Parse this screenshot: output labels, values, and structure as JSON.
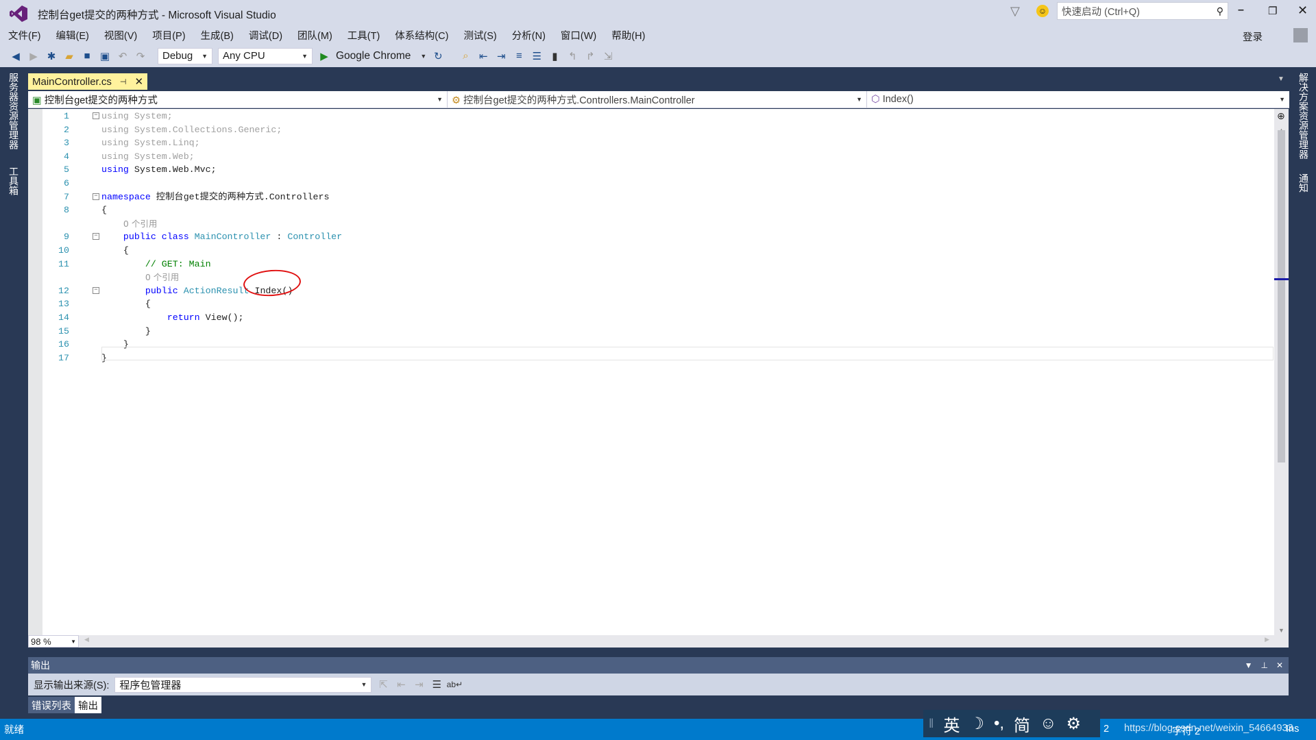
{
  "window": {
    "title": "控制台get提交的两种方式 - Microsoft Visual Studio",
    "quick_launch_placeholder": "快速启动 (Ctrl+Q)",
    "sign_in": "登录"
  },
  "menu": [
    "文件(F)",
    "编辑(E)",
    "视图(V)",
    "项目(P)",
    "生成(B)",
    "调试(D)",
    "团队(M)",
    "工具(T)",
    "体系结构(C)",
    "测试(S)",
    "分析(N)",
    "窗口(W)",
    "帮助(H)"
  ],
  "toolbar": {
    "config": "Debug",
    "platform": "Any CPU",
    "run_target": "Google Chrome"
  },
  "left_rail": [
    "服务器资源管理器",
    "工具箱"
  ],
  "right_rail": [
    "解决方案资源管理器",
    "通知"
  ],
  "doc_tab": {
    "name": "MainController.cs"
  },
  "nav": {
    "project": "控制台get提交的两种方式",
    "class": "控制台get提交的两种方式.Controllers.MainController",
    "member": "Index()"
  },
  "code": {
    "l1": "using System;",
    "l2": "using System.Collections.Generic;",
    "l3": "using System.Linq;",
    "l4": "using System.Web;",
    "l5_kw": "using",
    "l5_rest": " System.Web.Mvc;",
    "l7_kw": "namespace",
    "l7_rest": " 控制台get提交的两种方式.Controllers",
    "l8": "{",
    "lens": "0 个引用",
    "l9_kw": "public class",
    "l9_type": "MainController",
    "l9_colon": " : ",
    "l9_base": "Controller",
    "l10": "{",
    "l11": "// GET: Main",
    "l12_kw": "public",
    "l12_type": "ActionResult",
    "l12_rest": " Index()",
    "l13": "{",
    "l14_kw": "return",
    "l14_rest": " View();",
    "l15": "}",
    "l16": "}",
    "l17": "}"
  },
  "line_numbers": [
    "1",
    "2",
    "3",
    "4",
    "5",
    "6",
    "7",
    "8",
    "9",
    "10",
    "11",
    "12",
    "13",
    "14",
    "15",
    "16",
    "17"
  ],
  "zoom": "98 %",
  "output": {
    "title": "输出",
    "source_label": "显示输出来源(S):",
    "source_value": "程序包管理器",
    "tabs": [
      "错误列表",
      "输出"
    ]
  },
  "status": {
    "ready": "就绪",
    "col": "2",
    "char": "字符 2",
    "mode": "Ins",
    "watermark": "https://blog.csdn.net/weixin_54664933"
  },
  "ime": [
    "英",
    "☽",
    "•,",
    "简",
    "☺",
    "⚙"
  ],
  "colors": {
    "frame": "#293955",
    "status": "#007acc",
    "doc_tab": "#fff29d",
    "annotation": "#e01010"
  }
}
